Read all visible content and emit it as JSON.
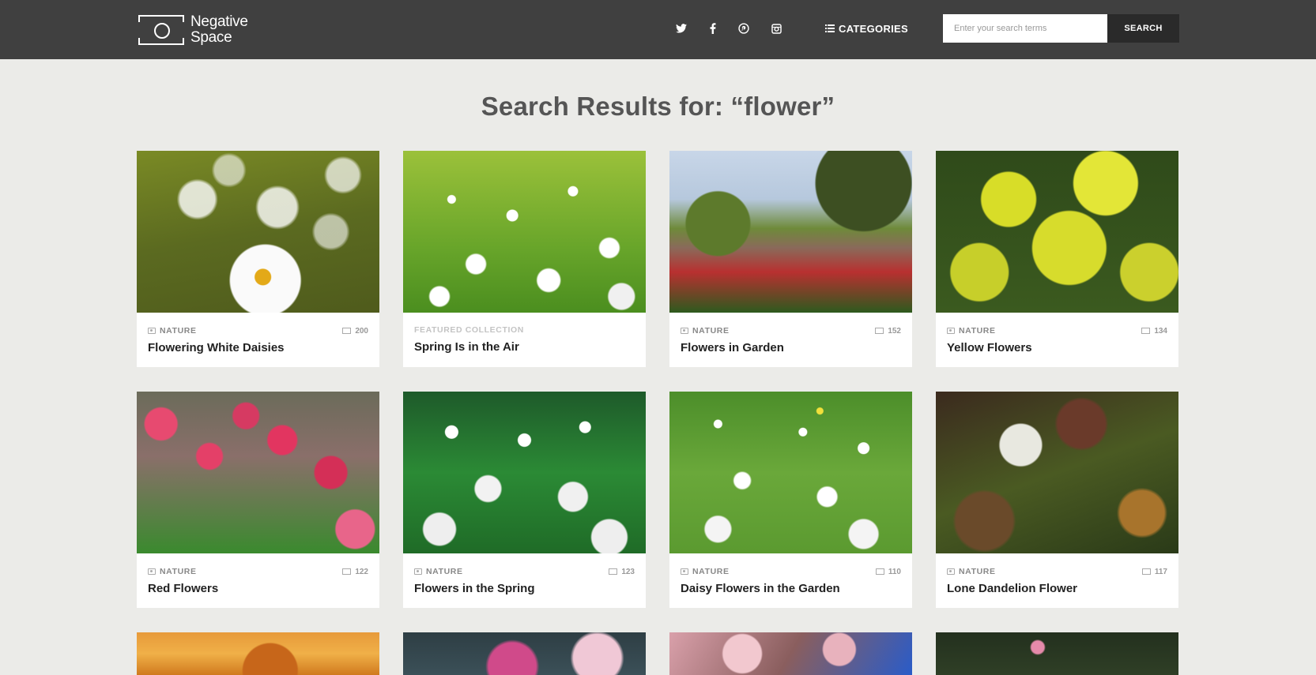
{
  "header": {
    "logo_line1": "Negative",
    "logo_line2": "Space",
    "social": [
      "twitter-icon",
      "facebook-icon",
      "pinterest-icon",
      "instagram-icon"
    ],
    "categories_label": "CATEGORIES",
    "search_placeholder": "Enter your search terms",
    "search_button": "SEARCH"
  },
  "results_title": "Search Results for: “flower”",
  "cards": [
    {
      "category": "NATURE",
      "count": "200",
      "title": "Flowering White Daisies"
    },
    {
      "featured": "FEATURED COLLECTION",
      "title": "Spring Is in the Air"
    },
    {
      "category": "NATURE",
      "count": "152",
      "title": "Flowers in Garden"
    },
    {
      "category": "NATURE",
      "count": "134",
      "title": "Yellow Flowers"
    },
    {
      "category": "NATURE",
      "count": "122",
      "title": "Red Flowers"
    },
    {
      "category": "NATURE",
      "count": "123",
      "title": "Flowers in the Spring"
    },
    {
      "category": "NATURE",
      "count": "110",
      "title": "Daisy Flowers in the Garden"
    },
    {
      "category": "NATURE",
      "count": "117",
      "title": "Lone Dandelion Flower"
    }
  ],
  "colors": {
    "header_bg": "#404040",
    "page_bg": "#ebebe8",
    "search_button_bg": "#2a2a2a"
  }
}
